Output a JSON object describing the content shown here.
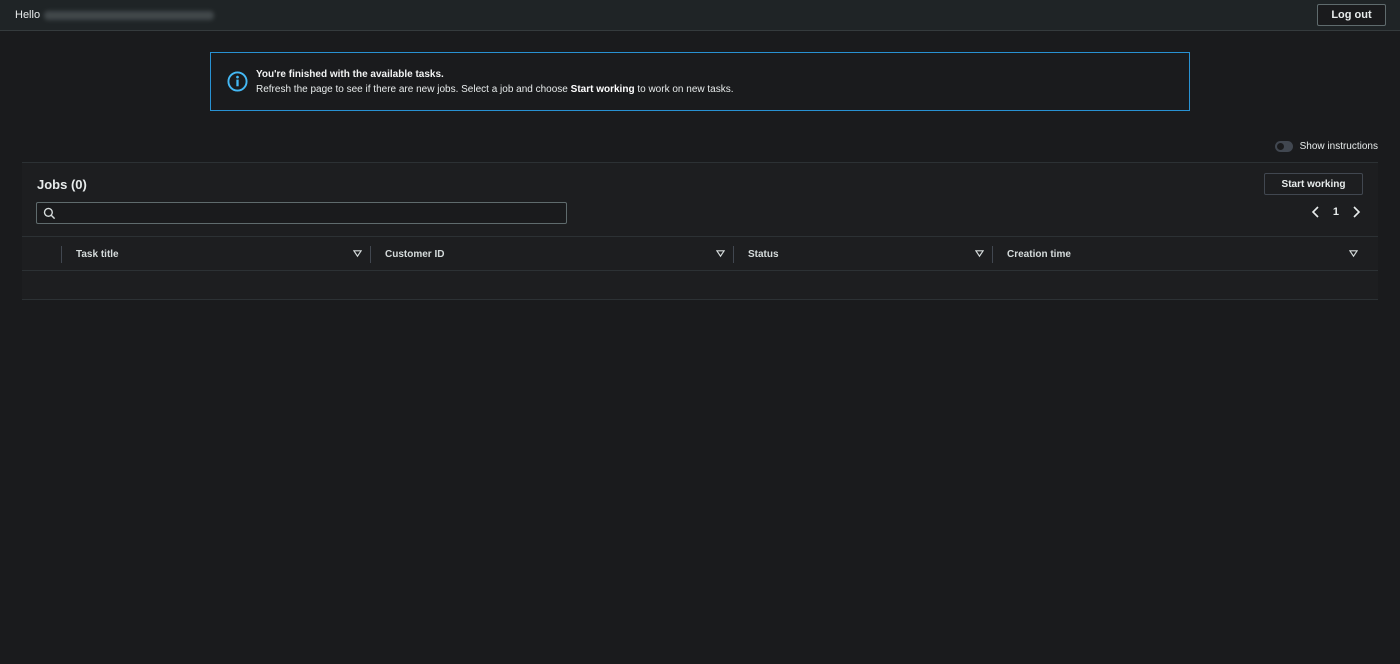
{
  "header": {
    "greeting": "Hello",
    "logout_label": "Log out"
  },
  "alert": {
    "title": "You're finished with the available tasks.",
    "body_prefix": "Refresh the page to see if there are new jobs. Select a job and choose ",
    "body_bold": "Start working",
    "body_suffix": " to work on new tasks.",
    "accent_color": "#2891d2",
    "icon": "info-icon"
  },
  "instructions": {
    "label": "Show instructions",
    "enabled": false
  },
  "jobs": {
    "title": "Jobs (0)",
    "start_label": "Start working",
    "search_placeholder": "",
    "page": "1",
    "columns": [
      "Task title",
      "Customer ID",
      "Status",
      "Creation time"
    ],
    "rows": []
  }
}
